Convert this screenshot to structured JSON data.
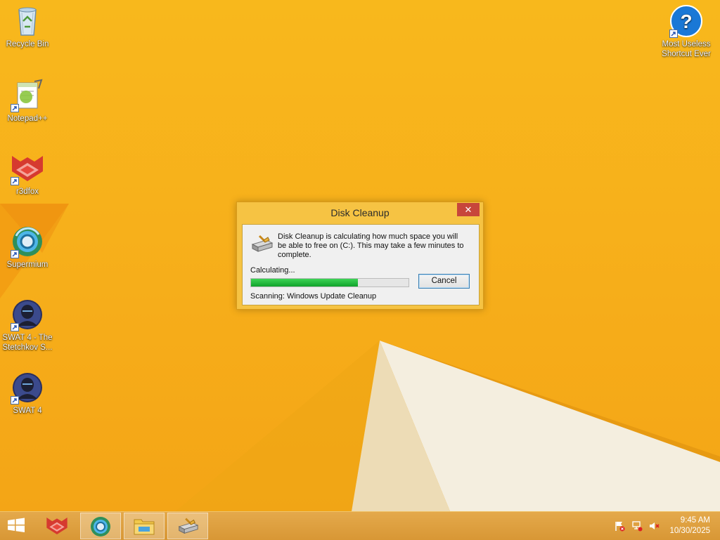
{
  "desktop": {
    "icons": [
      {
        "label": "Recycle Bin",
        "icon": "recycle-bin-icon",
        "shortcut": false
      },
      {
        "label": "Notepad++",
        "icon": "notepad-plus-plus-icon",
        "shortcut": true
      },
      {
        "label": "r3dfox",
        "icon": "r3dfox-icon",
        "shortcut": true
      },
      {
        "label": "Supermium",
        "icon": "supermium-icon",
        "shortcut": true
      },
      {
        "label": "SWAT 4 - The Stetchkov S...",
        "icon": "swat4-icon",
        "shortcut": true
      },
      {
        "label": "SWAT 4",
        "icon": "swat4-icon",
        "shortcut": true
      },
      {
        "label": "Most Useless Shortcut Ever",
        "icon": "help-question-icon",
        "shortcut": true
      }
    ]
  },
  "dialog": {
    "title": "Disk Cleanup",
    "close_label": "✕",
    "message": "Disk Cleanup is calculating how much space you will be able to free on  (C:). This may take a few minutes to complete.",
    "status_label": "Calculating...",
    "progress": 0.68,
    "cancel_label": "Cancel",
    "scanning": "Scanning:   Windows Update Cleanup"
  },
  "taskbar": {
    "items": [
      {
        "name": "start-button",
        "icon": "windows-logo-icon",
        "active": false
      },
      {
        "name": "taskbar-r3dfox",
        "icon": "r3dfox-icon",
        "active": false
      },
      {
        "name": "taskbar-supermium",
        "icon": "supermium-icon",
        "active": true
      },
      {
        "name": "taskbar-file-explorer",
        "icon": "file-explorer-icon",
        "active": true
      },
      {
        "name": "taskbar-disk-cleanup",
        "icon": "disk-cleanup-icon",
        "active": true
      }
    ],
    "tray_icons": [
      "action-center-flag-icon",
      "network-icon",
      "volume-muted-icon"
    ],
    "time": "9:45 AM",
    "date": "10/30/2025"
  },
  "colors": {
    "wallpaper": "#f7b21a",
    "dialog_frame": "#f6c343",
    "progress_fill": "#18b135",
    "close_button": "#c7463b"
  }
}
